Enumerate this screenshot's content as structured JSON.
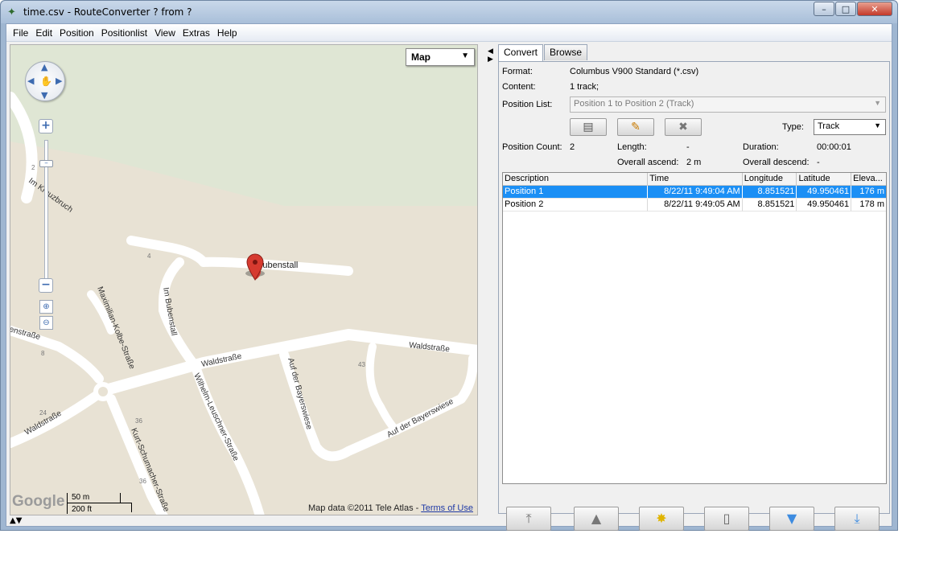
{
  "window": {
    "title": "time.csv - RouteConverter ? from ?",
    "buttons": {
      "minimize": "–",
      "maximize": "□",
      "close": "✕"
    }
  },
  "menu": [
    "File",
    "Edit",
    "Position",
    "Positionlist",
    "View",
    "Extras",
    "Help"
  ],
  "map": {
    "type_label": "Map",
    "marker_label": "Bubenstall",
    "street_labels": {
      "im_kreuzbruch": "Im Kreuzbruch",
      "im_bubenstall": "Im Bubenstall",
      "maximilian": "Maximilian-Kolbe-Straße",
      "waldstrasse_1": "Waldstraße",
      "waldstrasse_2": "Waldstraße",
      "waldstrasse_3": "Waldstraße",
      "wilhelm": "Wilhelm-Leuschner-Straße",
      "auf_der_bayerswiese_1": "Auf der Bayerswiese",
      "auf_der_bayerswiese_2": "Auf der Bayerswiese",
      "kurt": "Kurt-Schumacher-Straße",
      "enstrasse": "enstraße"
    },
    "house_numbers": [
      "2",
      "4",
      "8",
      "24",
      "36",
      "36",
      "43"
    ],
    "google_logo": "Google",
    "scale_metric": "50 m",
    "scale_imperial": "200 ft",
    "copyright": "Map data ©2011 Tele Atlas - ",
    "terms_link": "Terms of Use"
  },
  "panel": {
    "tabs": [
      "Convert",
      "Browse"
    ],
    "format_label": "Format:",
    "format_value": "Columbus V900 Standard (*.csv)",
    "content_label": "Content:",
    "content_value": "1 track;",
    "position_list_label": "Position List:",
    "position_list_value": "Position 1 to Position 2 (Track)",
    "type_label": "Type:",
    "type_value": "Track",
    "position_count_label": "Position Count:",
    "position_count_value": "2",
    "length_label": "Length:",
    "length_value": "-",
    "duration_label": "Duration:",
    "duration_value": "00:00:01",
    "overall_ascend_label": "Overall ascend:",
    "overall_ascend_value": "2 m",
    "overall_descend_label": "Overall descend:",
    "overall_descend_value": "-"
  },
  "table": {
    "headers": [
      "Description",
      "Time",
      "Longitude",
      "Latitude",
      "Eleva..."
    ],
    "rows": [
      {
        "description": "Position 1",
        "time": "8/22/11 9:49:04 AM",
        "longitude": "8.851521",
        "latitude": "49.950461",
        "elevation": "176 m",
        "selected": true
      },
      {
        "description": "Position 2",
        "time": "8/22/11 9:49:05 AM",
        "longitude": "8.851521",
        "latitude": "49.950461",
        "elevation": "178 m",
        "selected": false
      }
    ]
  },
  "colors": {
    "selection": "#1b8ff5",
    "map_background": "#e8e2d4",
    "map_park": "#dfe6d4",
    "marker": "#d63a2f"
  }
}
